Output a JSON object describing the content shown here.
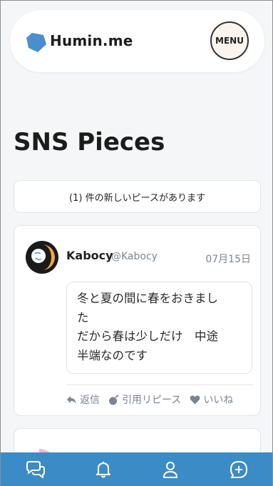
{
  "header": {
    "logo_text": "Humin.me",
    "menu_label": "MENU"
  },
  "page": {
    "title": "SNS Pieces"
  },
  "notice": {
    "text": "(1) 件の新しいピースがあります"
  },
  "post": {
    "author_name": "Kabocy",
    "author_handle": "@Kabocy",
    "date": "07月15日",
    "body_lines": [
      "冬と夏の間に春をおきまし",
      "た",
      "だから春は少しだけ　中途",
      "半端なのです"
    ],
    "actions": {
      "reply": "返信",
      "quote": "引用リピース",
      "like": "いいね"
    }
  },
  "tabbar": {
    "items": [
      "chat-icon",
      "bell-icon",
      "user-icon",
      "add-post-icon"
    ]
  },
  "colors": {
    "brand_blue": "#3b8cc6",
    "logo_blue": "#4a8ed0"
  }
}
